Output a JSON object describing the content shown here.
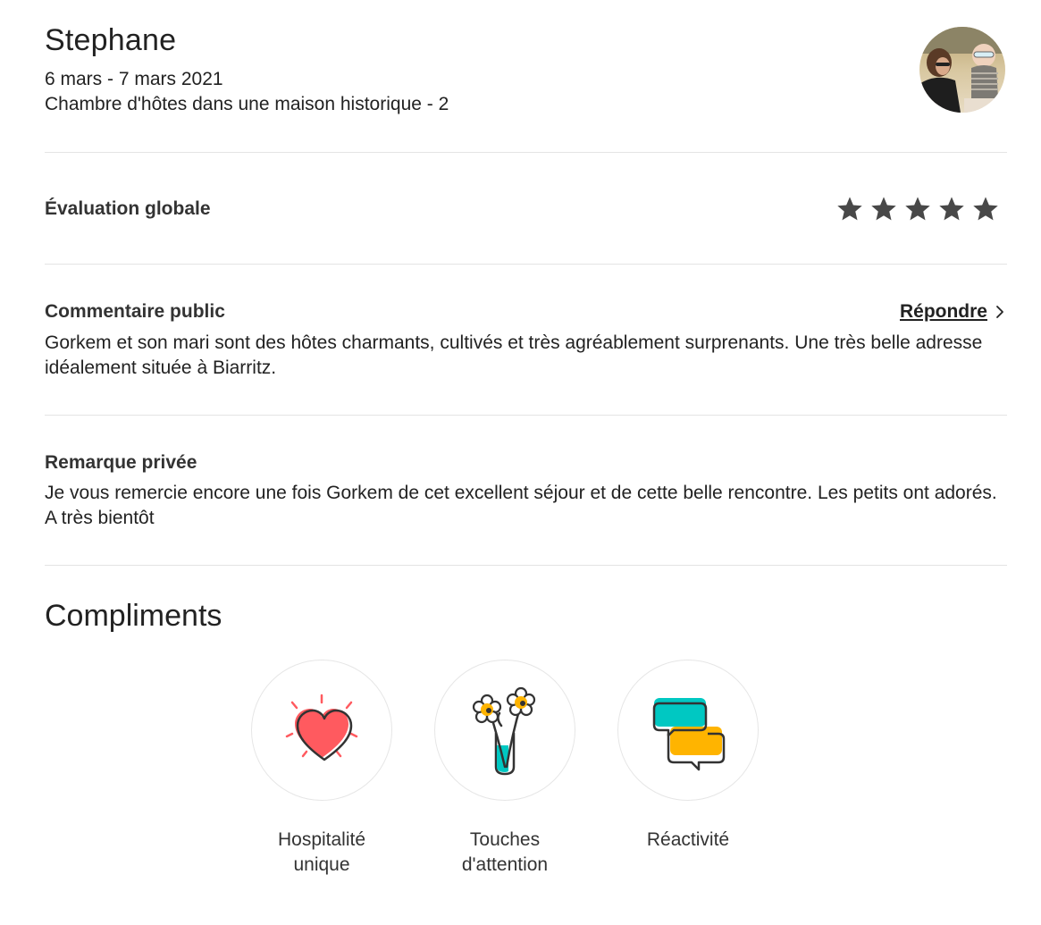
{
  "header": {
    "guest_name": "Stephane",
    "dates": "6 mars - 7 mars 2021",
    "listing": "Chambre d'hôtes dans une maison historique - 2"
  },
  "rating": {
    "label": "Évaluation globale",
    "stars": 5,
    "star_color": "#484848"
  },
  "public_comment": {
    "title": "Commentaire public",
    "reply_label": "Répondre",
    "text": "Gorkem et son mari sont des hôtes charmants, cultivés et très agréablement surprenants. Une très belle adresse idéalement située à Biarritz."
  },
  "private_note": {
    "title": "Remarque privée",
    "text": "Je vous remercie encore une fois Gorkem de cet excellent séjour et de cette belle rencontre. Les petits ont adorés. A très bientôt"
  },
  "compliments": {
    "title": "Compliments",
    "items": [
      {
        "label_line1": "Hospitalité",
        "label_line2": "unique",
        "icon": "heart-icon"
      },
      {
        "label_line1": "Touches",
        "label_line2": "d'attention",
        "icon": "flowers-vase-icon"
      },
      {
        "label_line1": "Réactivité",
        "label_line2": "",
        "icon": "chat-bubbles-icon"
      }
    ]
  },
  "colors": {
    "heart_red": "#ff5a5f",
    "teal": "#00c8c2",
    "yellow": "#ffb400",
    "outline": "#333333"
  }
}
